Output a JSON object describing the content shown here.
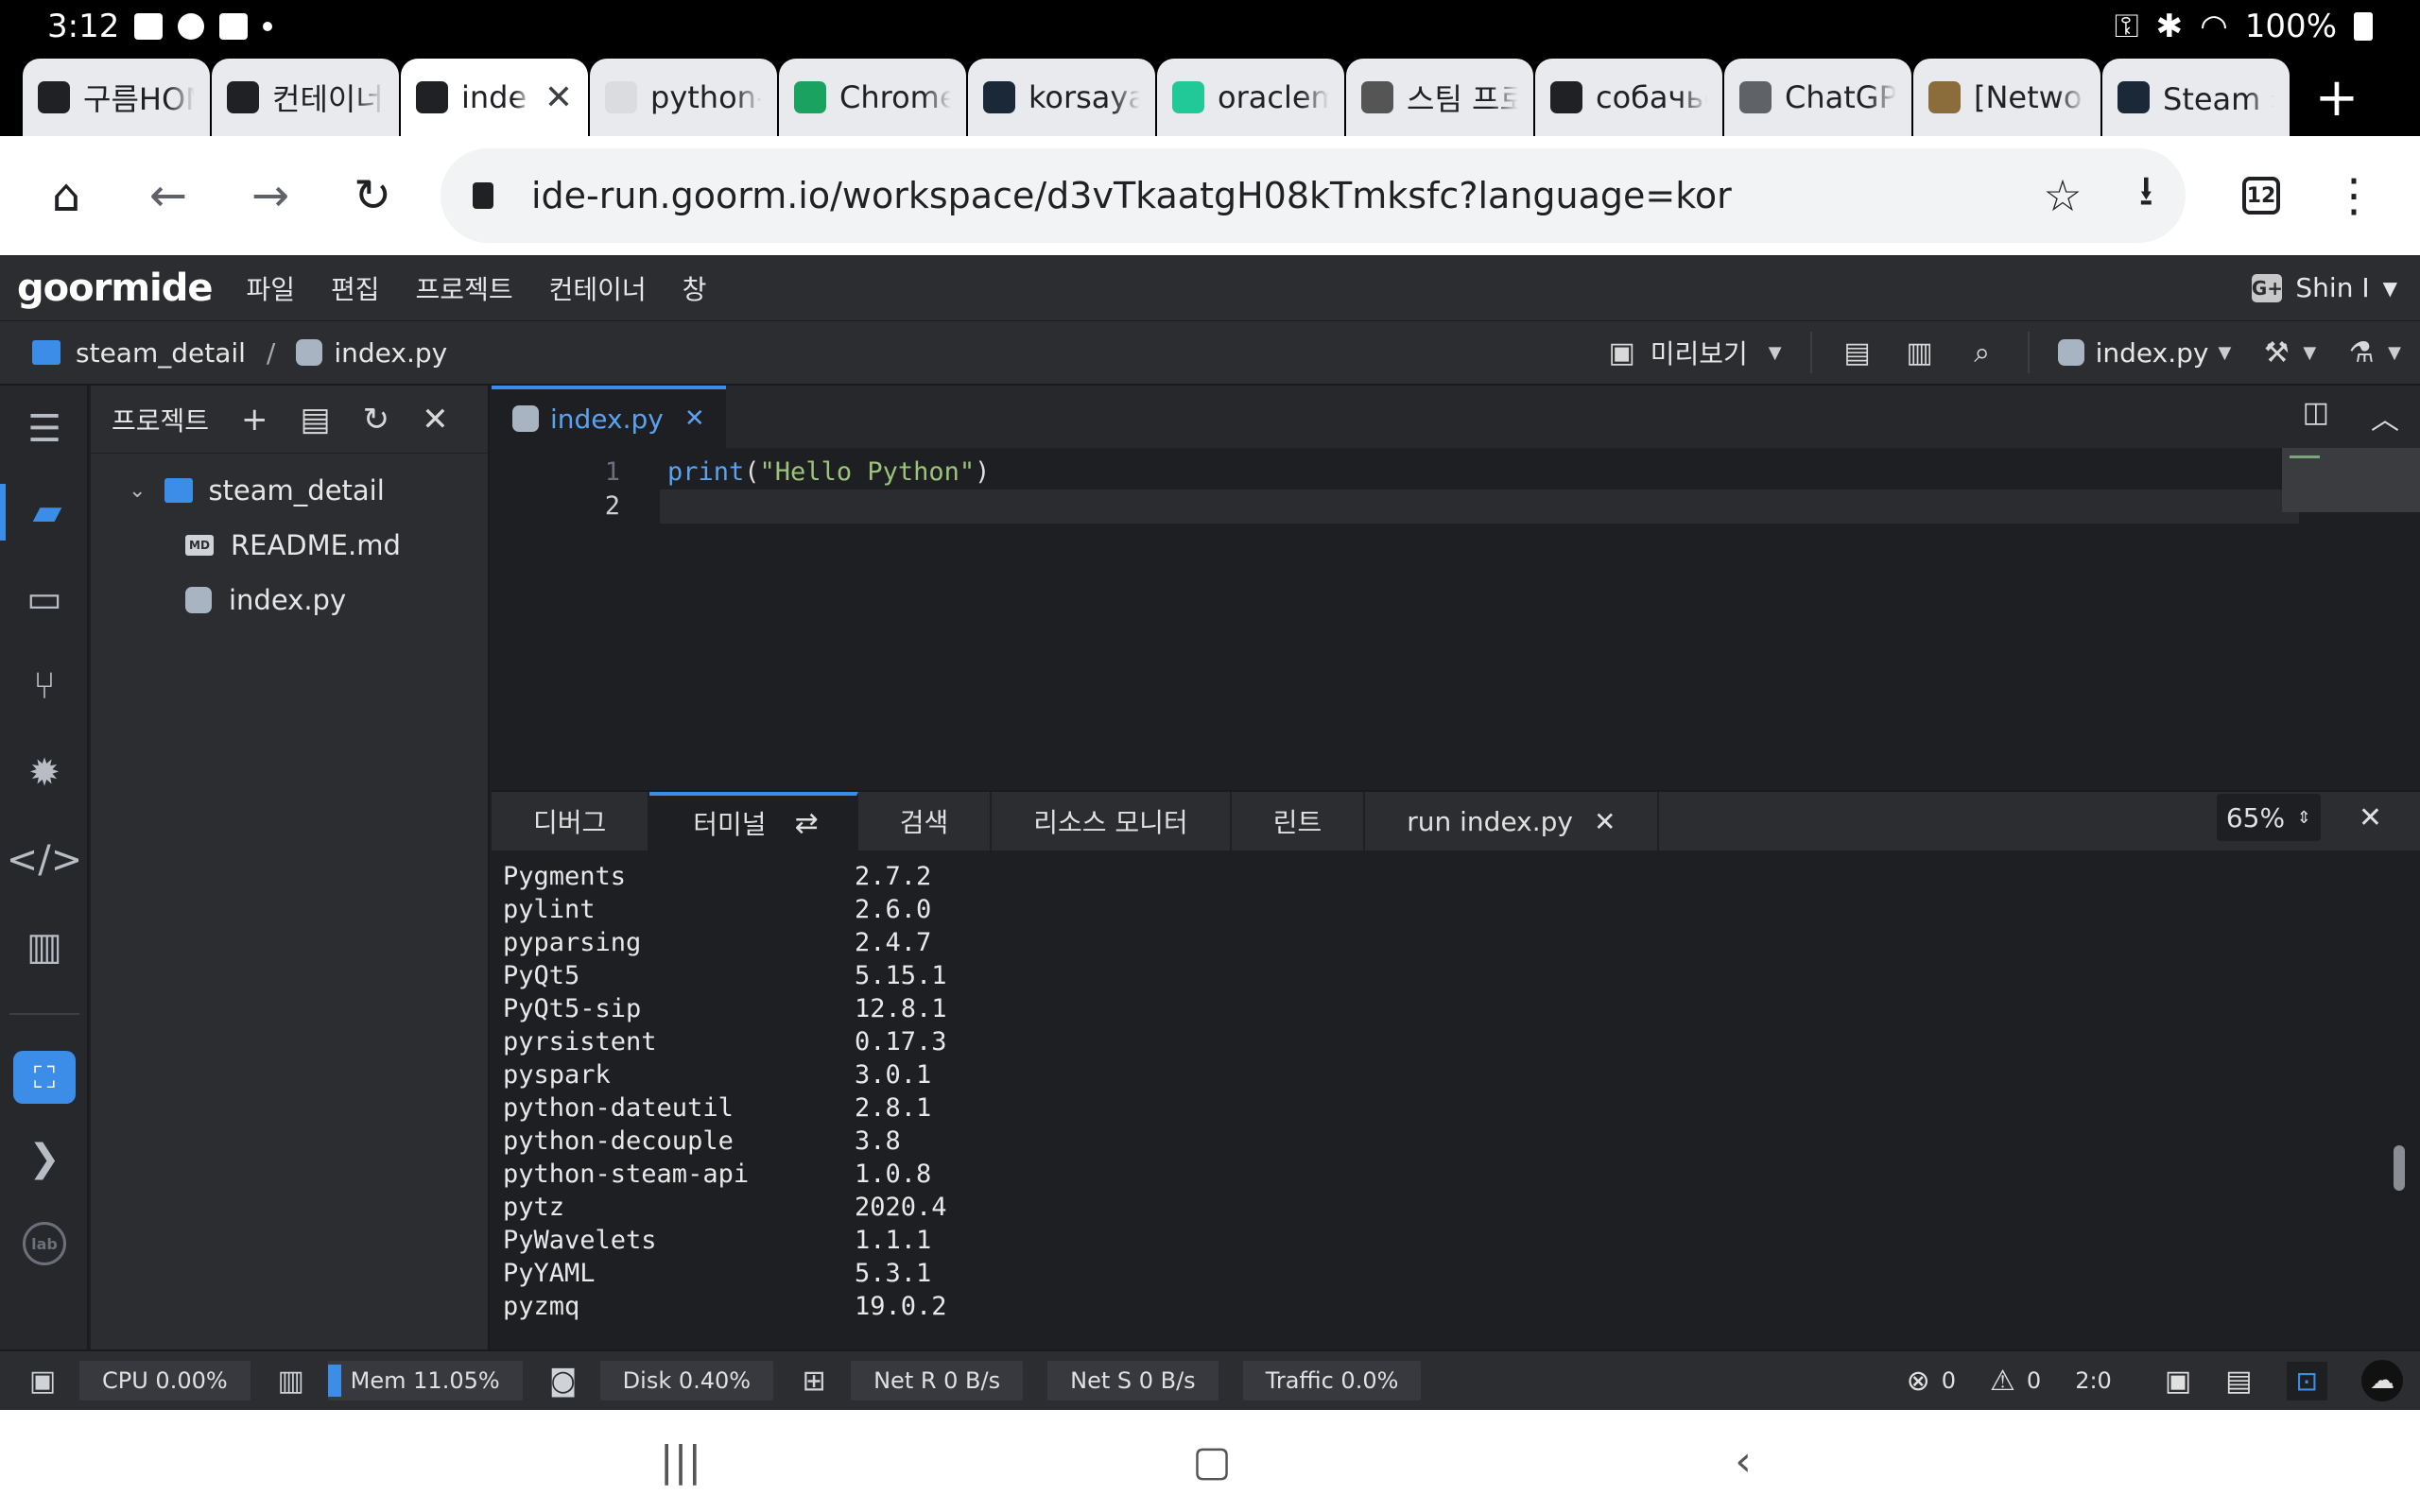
{
  "status_bar": {
    "time": "3:12",
    "battery": "100%"
  },
  "browser_tabs": [
    {
      "label": "구름HOM",
      "icon": "goorm-icon",
      "color": "#202124"
    },
    {
      "label": "컨테이너",
      "icon": "terminal-icon",
      "color": "#202124"
    },
    {
      "label": "inde",
      "icon": "terminal-icon",
      "color": "#202124",
      "active": true
    },
    {
      "label": "python-s",
      "icon": "page-icon",
      "color": "#dadce0"
    },
    {
      "label": "Chrome",
      "icon": "chrome-remote-icon",
      "color": "#1aa260"
    },
    {
      "label": "korsaya",
      "icon": "steam-icon",
      "color": "#1b2838"
    },
    {
      "label": "oraclem",
      "icon": "velog-icon",
      "color": "#20c997"
    },
    {
      "label": "스팀 프로",
      "icon": "avatar-icon",
      "color": "#555555"
    },
    {
      "label": "собачье",
      "icon": "stack-icon",
      "color": "#202124"
    },
    {
      "label": "ChatGPT",
      "icon": "globe-icon",
      "color": "#5f6368"
    },
    {
      "label": "[Networ",
      "icon": "penguin-icon",
      "color": "#8a6d3b"
    },
    {
      "label": "Steam 커",
      "icon": "steam-icon",
      "color": "#1b2838"
    }
  ],
  "browser": {
    "url": "ide-run.goorm.io/workspace/d3vTkaatgH08kTmksfc?language=kor",
    "tab_count": "12"
  },
  "ide": {
    "logo": "goormide",
    "menu": [
      "파일",
      "편집",
      "프로젝트",
      "컨테이너",
      "창"
    ],
    "user": "Shin I",
    "breadcrumb": {
      "folder": "steam_detail",
      "file": "index.py"
    },
    "preview_label": "미리보기",
    "run_target": "index.py"
  },
  "project_panel": {
    "title": "프로젝트",
    "root": "steam_detail",
    "files": [
      {
        "name": "README.md",
        "type": "md"
      },
      {
        "name": "index.py",
        "type": "py"
      }
    ]
  },
  "editor": {
    "tab": "index.py",
    "line_numbers": [
      "1",
      "2"
    ],
    "code": {
      "func": "print",
      "open": "(",
      "string": "\"Hello Python\"",
      "close": ")"
    }
  },
  "bottom_panel": {
    "tabs": [
      "디버그",
      "터미널",
      "검색",
      "리소스 모니터",
      "린트",
      "run index.py"
    ],
    "zoom": "65%"
  },
  "terminal_rows": [
    [
      "Pygments",
      "2.7.2"
    ],
    [
      "pylint",
      "2.6.0"
    ],
    [
      "pyparsing",
      "2.4.7"
    ],
    [
      "PyQt5",
      "5.15.1"
    ],
    [
      "PyQt5-sip",
      "12.8.1"
    ],
    [
      "pyrsistent",
      "0.17.3"
    ],
    [
      "pyspark",
      "3.0.1"
    ],
    [
      "python-dateutil",
      "2.8.1"
    ],
    [
      "python-decouple",
      "3.8"
    ],
    [
      "python-steam-api",
      "1.0.8"
    ],
    [
      "pytz",
      "2020.4"
    ],
    [
      "PyWavelets",
      "1.1.1"
    ],
    [
      "PyYAML",
      "5.3.1"
    ],
    [
      "pyzmq",
      "19.0.2"
    ]
  ],
  "status": {
    "cpu": "CPU 0.00%",
    "mem": "Mem 11.05%",
    "disk": "Disk 0.40%",
    "net_r": "Net R 0 B/s",
    "net_s": "Net S 0 B/s",
    "traffic": "Traffic 0.0%",
    "errors": "0",
    "warnings": "0",
    "cursor": "2:0"
  },
  "colors": {
    "accent": "#3b8de8",
    "string": "#9bc47a",
    "keyword": "#5aa2f0"
  }
}
